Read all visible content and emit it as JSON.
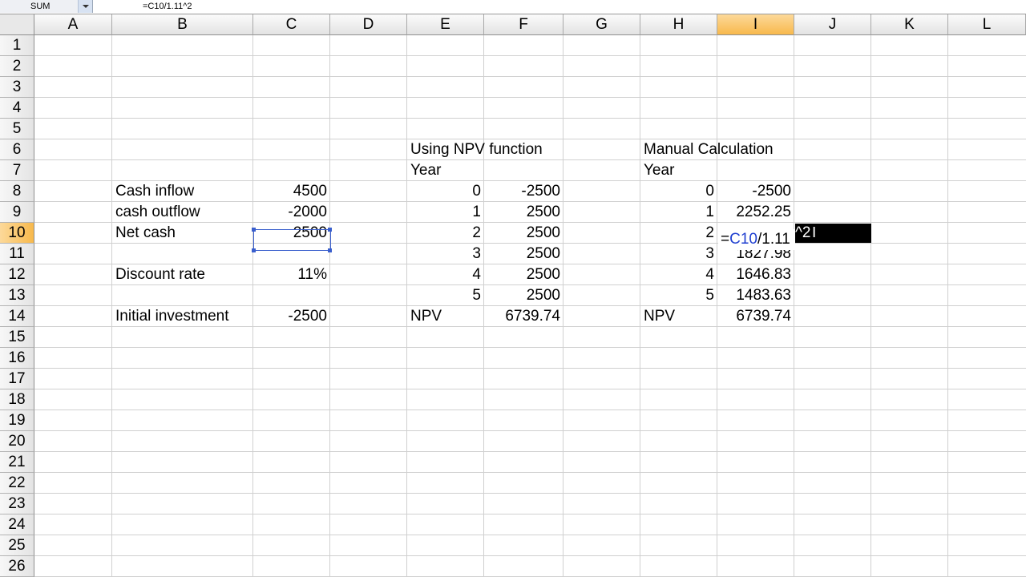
{
  "formula_bar": {
    "name_box": "SUM",
    "formula": "=C10/1.11^2"
  },
  "columns": [
    "A",
    "B",
    "C",
    "D",
    "E",
    "F",
    "G",
    "H",
    "I",
    "J",
    "K",
    "L"
  ],
  "selected_column": "I",
  "rows": [
    "1",
    "2",
    "3",
    "4",
    "5",
    "6",
    "7",
    "8",
    "9",
    "10",
    "11",
    "12",
    "13",
    "14",
    "15",
    "16",
    "17",
    "18",
    "19",
    "20",
    "21",
    "22",
    "23",
    "24",
    "25",
    "26"
  ],
  "selected_row": "10",
  "cells": {
    "B8": "Cash inflow",
    "C8": "4500",
    "B9": "cash outflow",
    "C9": "-2000",
    "B10": "Net cash",
    "C10": "2500",
    "B12": "Discount rate",
    "C12": "11%",
    "B14": "Initial investment",
    "C14": "-2500",
    "E6": "Using NPV function",
    "E7": "Year",
    "E8": "0",
    "F8": "-2500",
    "E9": "1",
    "F9": "2500",
    "E10": "2",
    "F10": "2500",
    "E11": "3",
    "F11": "2500",
    "E12": "4",
    "F12": "2500",
    "E13": "5",
    "F13": "2500",
    "E14": "NPV",
    "F14": "6739.74",
    "H6": "Manual Calculation",
    "H7": "Year",
    "H8": "0",
    "I8": "-2500",
    "H9": "1",
    "I9": "2252.25",
    "H10": "2",
    "H11": "3",
    "I11": "1827.98",
    "H12": "4",
    "I12": "1646.83",
    "H13": "5",
    "I13": "1483.63",
    "H14": "NPV",
    "I14": "6739.74"
  },
  "editing": {
    "cell": "I10",
    "eq": "=",
    "ref": "C10",
    "rest": "/1.11",
    "overflow": "^2"
  }
}
